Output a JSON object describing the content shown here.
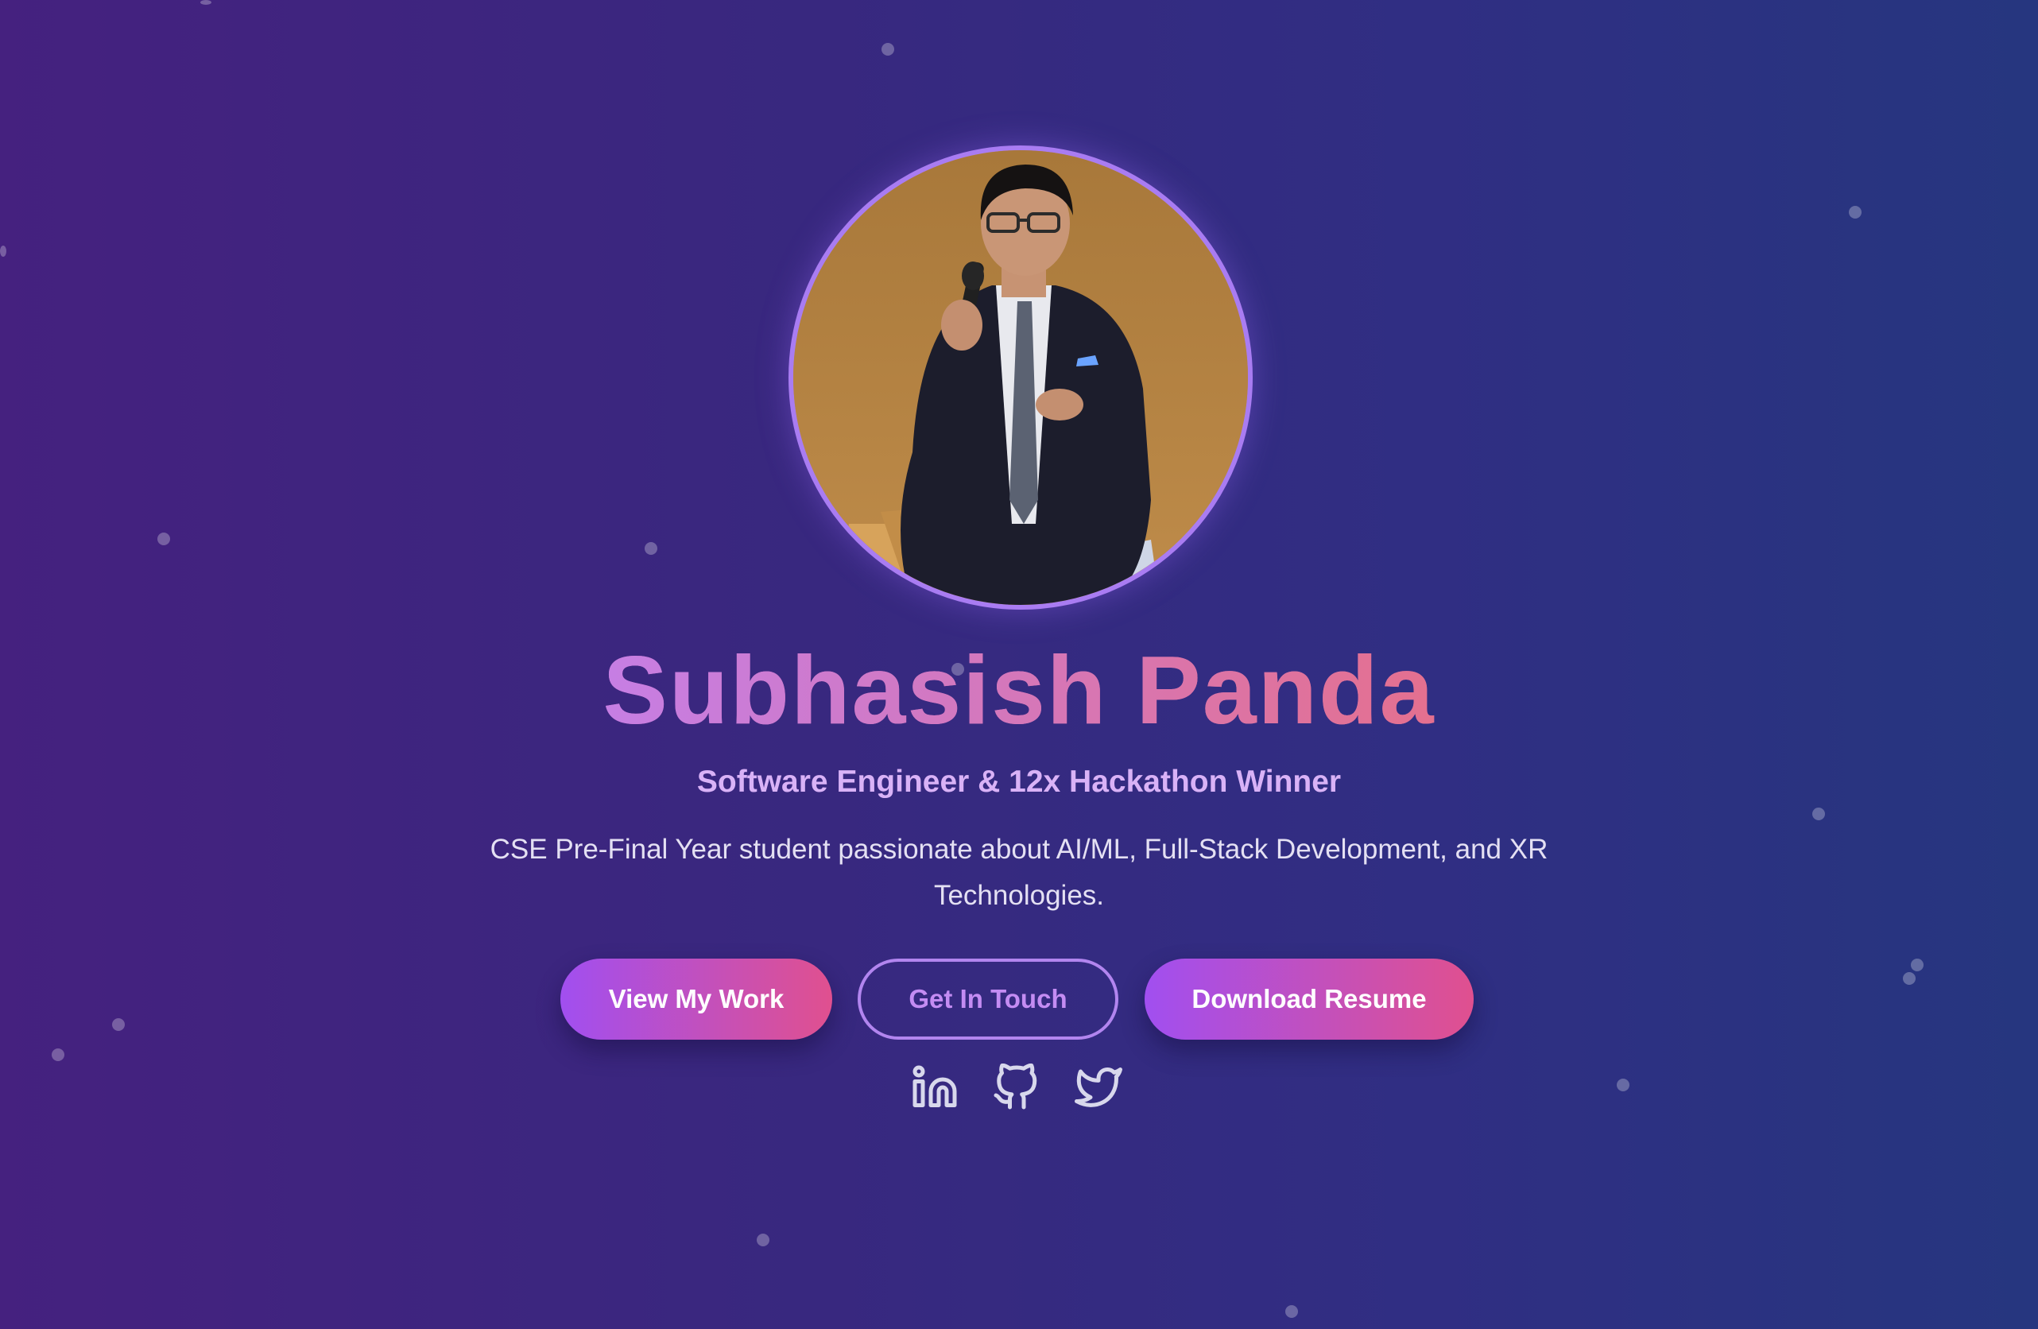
{
  "profile": {
    "name": "Subhasish Panda",
    "tagline": "Software Engineer & 12x Hackathon Winner",
    "description": "CSE Pre-Final Year student passionate about AI/ML, Full-Stack Development, and XR Technologies.",
    "photo_alt": "Subhasish Panda speaking"
  },
  "actions": {
    "view_work": "View My Work",
    "get_in_touch": "Get In Touch",
    "download_resume": "Download Resume"
  },
  "social": {
    "linkedin": "linkedin-icon",
    "github": "github-icon",
    "twitter": "twitter-icon"
  },
  "colors": {
    "accent_purple": "#a14ff0",
    "accent_pink": "#e0508f",
    "outline": "#b285ef",
    "tagline": "#d9b2f7"
  }
}
